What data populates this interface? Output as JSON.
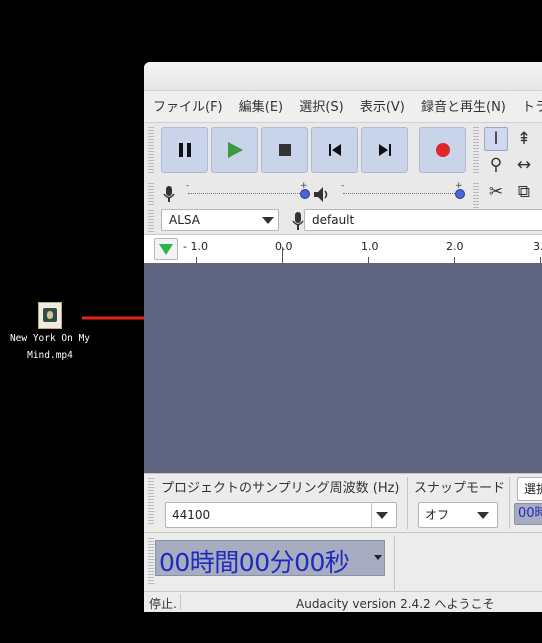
{
  "desktop": {
    "file_name_line1": "New York On My",
    "file_name_line2": "Mind.mp4",
    "file_icon": "video-file-icon"
  },
  "annotation": {
    "arrow_color": "#e8231a"
  },
  "app": {
    "menu": [
      "ファイル(F)",
      "編集(E)",
      "選択(S)",
      "表示(V)",
      "録音と再生(N)",
      "トラ"
    ],
    "transport": {
      "pause_icon": "pause-icon",
      "play_icon": "play-icon",
      "stop_icon": "stop-icon",
      "skip_start_icon": "skip-to-start-icon",
      "skip_end_icon": "skip-to-end-icon",
      "record_icon": "record-icon",
      "button_color": "#c9d3ea",
      "play_color": "#3a9a3f",
      "record_color": "#e0262b"
    },
    "meters": {
      "minus": "-",
      "plus": "+"
    },
    "device": {
      "host": "ALSA",
      "input": "default"
    },
    "ruler": {
      "labels": [
        "- 1.0",
        "0.0",
        "1.0",
        "2.0",
        "3."
      ]
    },
    "track_color": "#5f6480",
    "bottom": {
      "rate_label": "プロジェクトのサンプリング周波数 (Hz)",
      "rate_value": "44100",
      "snap_label": "スナップモード",
      "snap_value": "オフ",
      "select_label": "選択",
      "select_time_partial": "00時",
      "time_display": "00時間00分00秒"
    },
    "status": {
      "state": "停止.",
      "welcome": "Audacity version 2.4.2 へようこそ"
    }
  }
}
